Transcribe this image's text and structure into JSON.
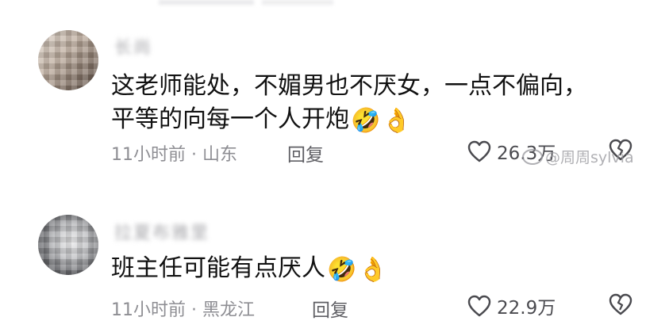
{
  "comments": [
    {
      "username": "长尚",
      "lines": [
        "这老师能处，不媚男也不厌女，一点不偏向，",
        "平等的向每一个人开炮"
      ],
      "emojis": [
        "🤣",
        "👌"
      ],
      "time": "11小时前",
      "location": "山东",
      "reply_label": "回复",
      "likes": "26.3万"
    },
    {
      "username": "拉夏布雅里",
      "lines": [
        "班主任可能有点厌人"
      ],
      "emojis": [
        "🤣",
        "👌"
      ],
      "time": "11小时前",
      "location": "黑龙江",
      "reply_label": "回复",
      "likes": "22.9万"
    }
  ],
  "meta_separator": " · ",
  "watermark": "@周周sylvia",
  "icons": {
    "like": "heart-icon",
    "dislike": "broken-heart-icon",
    "watermark_logo": "weibo-logo-icon"
  }
}
